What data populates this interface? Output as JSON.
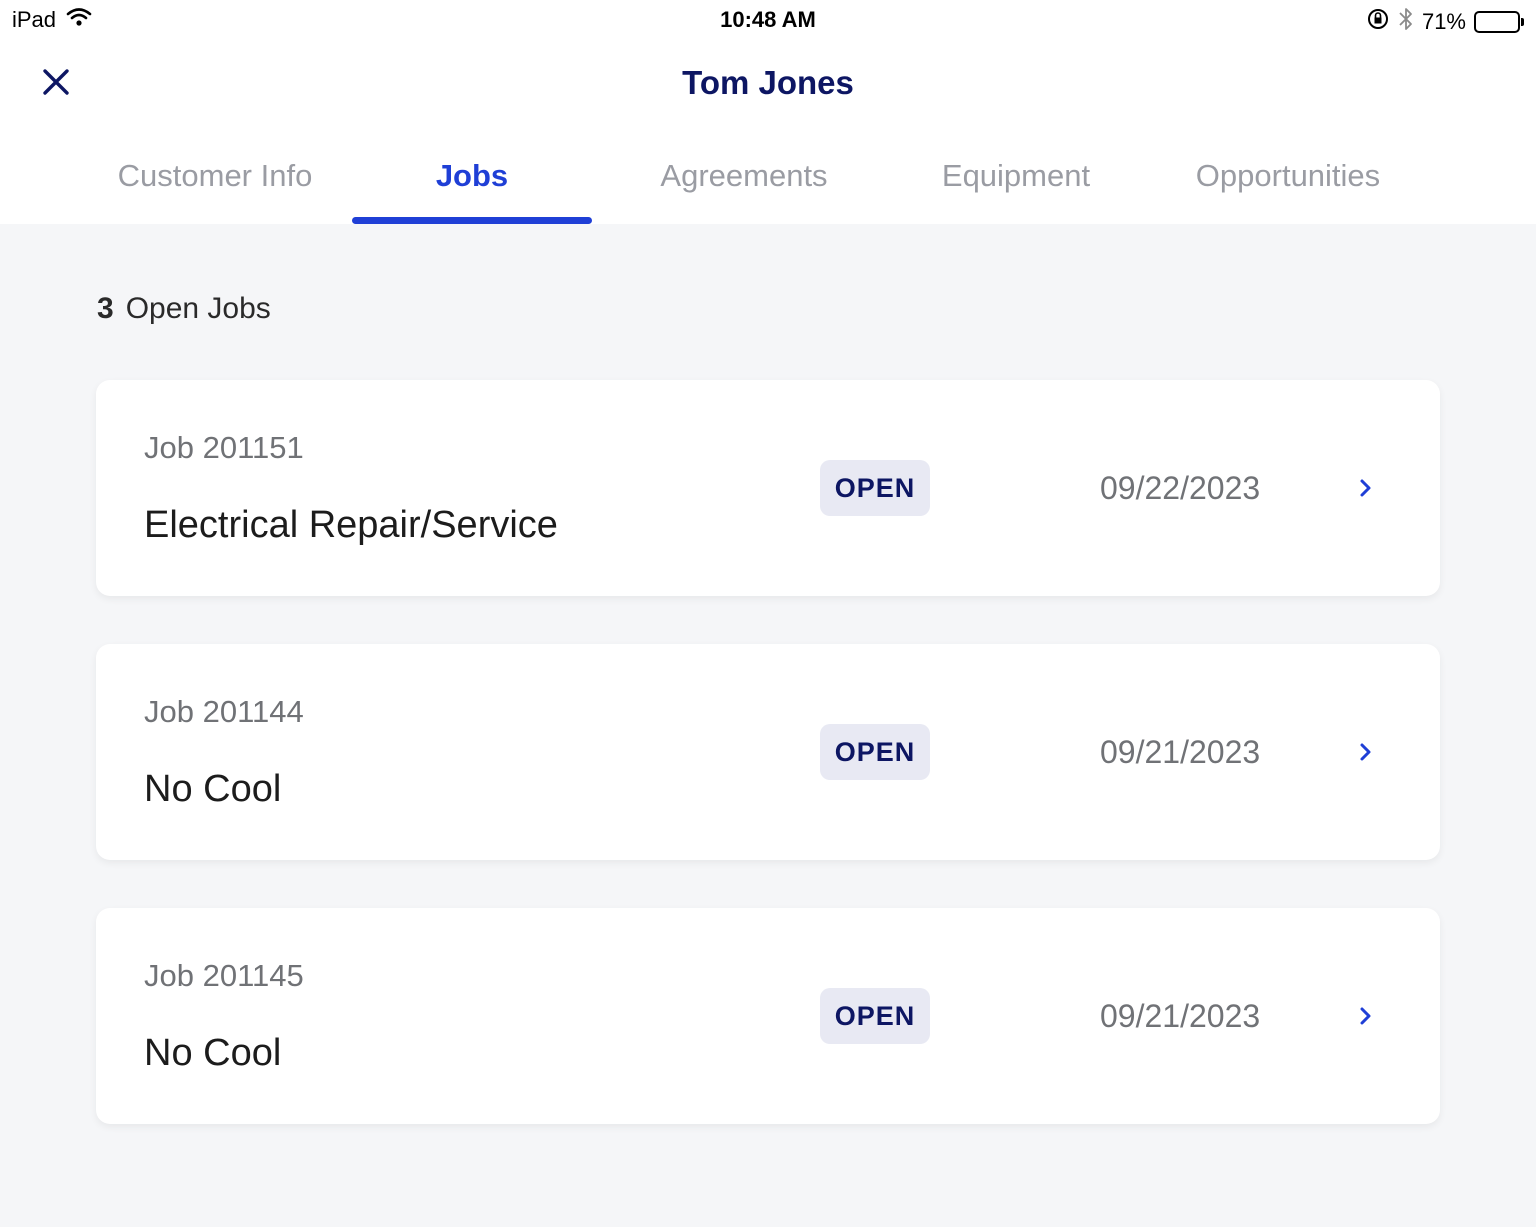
{
  "status_bar": {
    "device": "iPad",
    "time": "10:48 AM",
    "battery_percent": "71%",
    "battery_level": 0.71,
    "icons": [
      "wifi-icon",
      "orientation-lock-icon",
      "bluetooth-icon",
      "battery-icon"
    ]
  },
  "header": {
    "title": "Tom Jones",
    "close_icon": "close-icon"
  },
  "tabs": [
    {
      "label": "Customer Info",
      "active": false
    },
    {
      "label": "Jobs",
      "active": true
    },
    {
      "label": "Agreements",
      "active": false
    },
    {
      "label": "Equipment",
      "active": false
    },
    {
      "label": "Opportunities",
      "active": false
    }
  ],
  "summary": {
    "count": "3",
    "label": "Open Jobs"
  },
  "jobs": [
    {
      "number": "Job 201151",
      "title": "Electrical Repair/Service",
      "status": "OPEN",
      "date": "09/22/2023"
    },
    {
      "number": "Job 201144",
      "title": "No Cool",
      "status": "OPEN",
      "date": "09/21/2023"
    },
    {
      "number": "Job 201145",
      "title": "No Cool",
      "status": "OPEN",
      "date": "09/21/2023"
    }
  ],
  "colors": {
    "accent": "#1f3fd6",
    "navy": "#0d1663",
    "badge_bg": "#e8e9f3",
    "background": "#f5f6f8"
  }
}
